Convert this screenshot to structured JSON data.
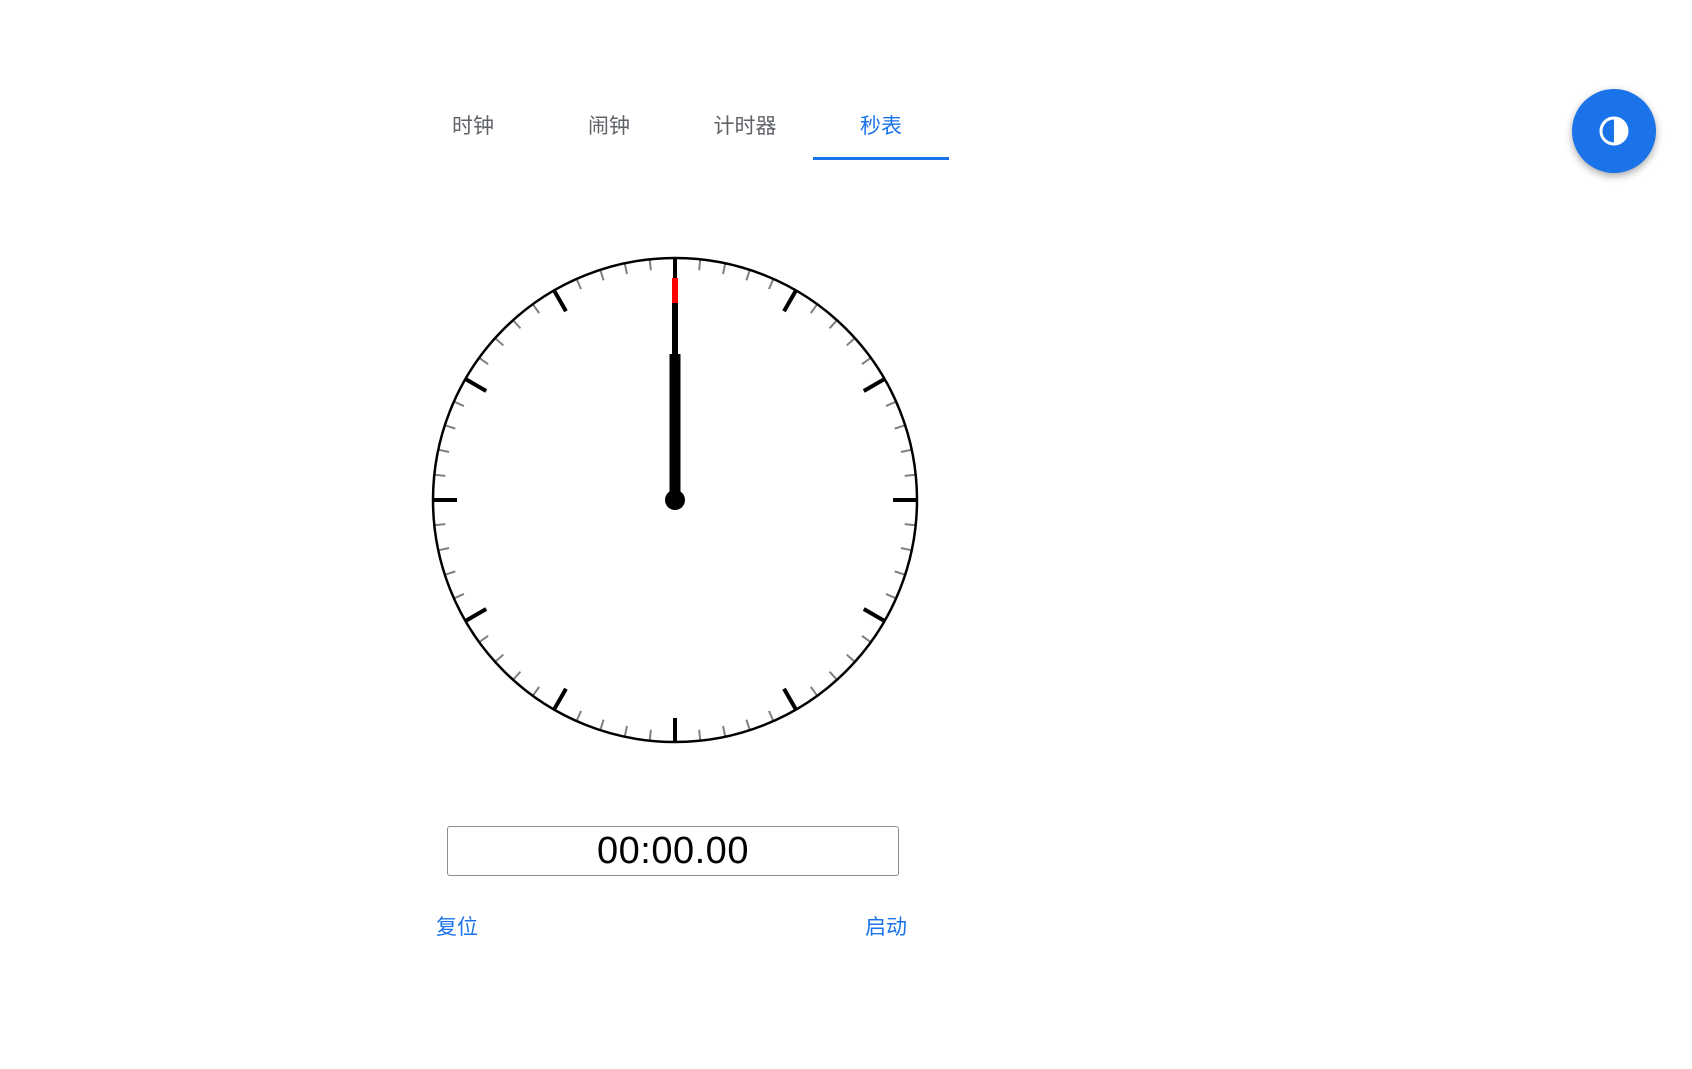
{
  "tabs": [
    {
      "label": "时钟",
      "active": false
    },
    {
      "label": "闹钟",
      "active": false
    },
    {
      "label": "计时器",
      "active": false
    },
    {
      "label": "秒表",
      "active": true
    }
  ],
  "theme_toggle": {
    "icon": "half-circle-contrast-icon"
  },
  "stopwatch": {
    "display": "00:00.00",
    "reset_label": "复位",
    "start_label": "启动",
    "elapsed_seconds": 0
  },
  "colors": {
    "accent": "#1a73e8",
    "second_hand": "#ff0000",
    "major_tick": "#000000",
    "minor_tick": "#808080",
    "tab_inactive": "#5f6368"
  }
}
